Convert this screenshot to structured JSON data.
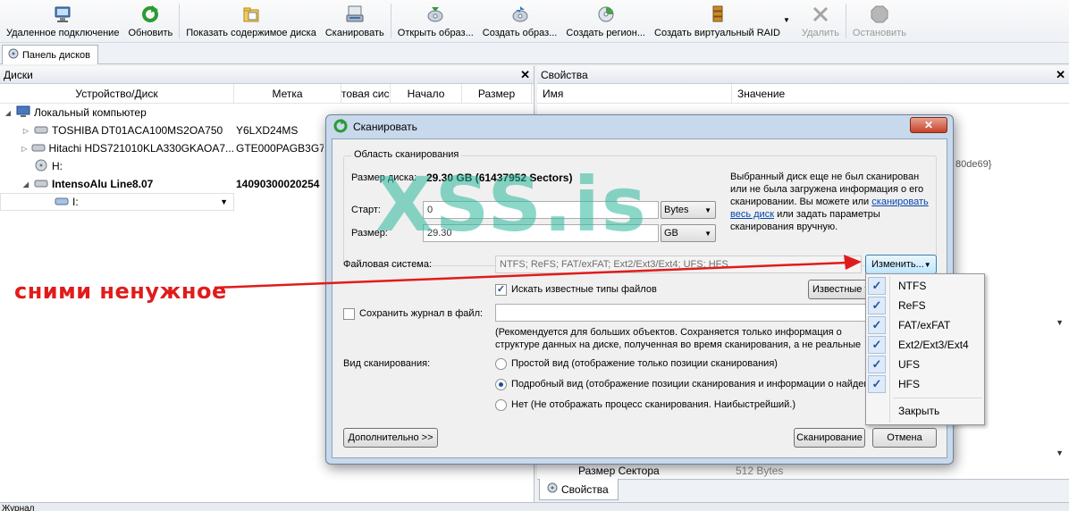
{
  "toolbar": {
    "items": [
      {
        "label": "Удаленное подключение",
        "icon": "remote-computer-icon"
      },
      {
        "label": "Обновить",
        "icon": "refresh-icon"
      },
      {
        "label": "Показать содержимое диска",
        "icon": "folder-view-icon"
      },
      {
        "label": "Сканировать",
        "icon": "scan-icon"
      },
      {
        "label": "Открыть образ...",
        "icon": "open-image-icon"
      },
      {
        "label": "Создать образ...",
        "icon": "create-image-icon"
      },
      {
        "label": "Создать регион...",
        "icon": "create-region-icon"
      },
      {
        "label": "Создать виртуальный RAID",
        "icon": "raid-icon"
      },
      {
        "label": "Удалить",
        "icon": "delete-icon"
      },
      {
        "label": "Остановить",
        "icon": "stop-icon"
      }
    ]
  },
  "tabs": {
    "disks_tab": "Панель дисков"
  },
  "disks": {
    "title": "Диски",
    "columns": [
      "Устройство/Диск",
      "Метка",
      "товая сис",
      "Начало",
      "Размер"
    ],
    "rows": [
      {
        "name": "Локальный компьютер",
        "label": ""
      },
      {
        "name": "TOSHIBA DT01ACA100MS2OA750",
        "label": "Y6LXD24MS"
      },
      {
        "name": "Hitachi HDS721010KLA330GKAOA7...",
        "label": "GTE000PAGB3G7E"
      },
      {
        "name": "H:",
        "label": ""
      },
      {
        "name": "IntensoAlu Line8.07",
        "label": "14090300020254"
      },
      {
        "name": "I:",
        "label": ""
      }
    ]
  },
  "properties": {
    "title": "Свойства",
    "columns": [
      "Имя",
      "Значение"
    ],
    "peek_right": "80de69}",
    "bottom_row_name": "Размер Сектора",
    "bottom_row_value": "512 Bytes",
    "tab": "Свойства"
  },
  "journal": {
    "label": "Журнал"
  },
  "annotation": {
    "text": "сними ненужное"
  },
  "watermark": "XSS.is",
  "dialog": {
    "title": "Сканировать",
    "area_title": "Область сканирования",
    "disk_size_label": "Размер диска:",
    "disk_size_value": "29.30 GB (61437952 Sectors)",
    "start_label": "Старт:",
    "start_value": "0",
    "start_unit": "Bytes",
    "size_label": "Размер:",
    "size_value": "29.30",
    "size_unit": "GB",
    "info_text_1": "Выбранный диск еще не был сканирован или не была загружена информация о его сканировании. Вы можете или",
    "info_link": "сканировать весь диск",
    "info_text_2": "или задать параметры сканирования вручную.",
    "fs_label": "Файловая система:",
    "fs_value": "NTFS; ReFS; FAT/exFAT; Ext2/Ext3/Ext4; UFS; HFS",
    "change_button": "Изменить...",
    "known_types_checkbox": "Искать известные типы файлов",
    "known_types_button": "Известные т",
    "save_log_checkbox": "Сохранить журнал в файл:",
    "log_note": "(Рекомендуется для больших объектов. Сохраняется только информация о структуре данных на диске, полученная во время сканирования, а не реальные данные.)",
    "scan_view_label": "Вид сканирования:",
    "radio_simple": "Простой вид (отображение только позиции сканирования)",
    "radio_detailed": "Подробный вид (отображение позиции сканирования и информации о найденных",
    "radio_none": "Нет (Не отображать процесс сканирования. Наибыстрейший.)",
    "advanced_button": "Дополнительно >>",
    "scan_button": "Сканирование",
    "cancel_button": "Отмена"
  },
  "fs_menu": {
    "items": [
      "NTFS",
      "ReFS",
      "FAT/exFAT",
      "Ext2/Ext3/Ext4",
      "UFS",
      "HFS"
    ],
    "close": "Закрыть"
  }
}
